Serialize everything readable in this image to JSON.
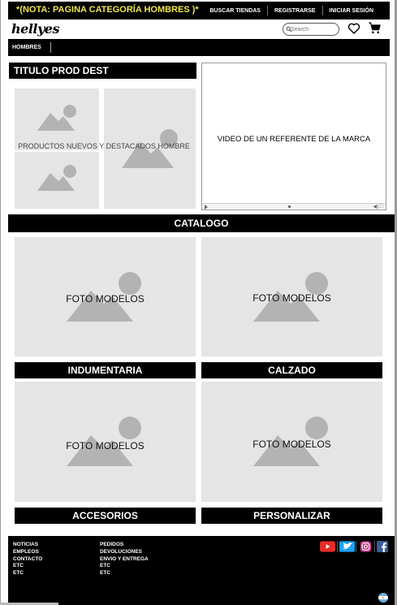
{
  "topbar": {
    "note": "*(NOTA: PAGINA CATEGORÍA HOMBRES )*",
    "links": [
      "BUSCAR TIENDAS",
      "REGISTRARSE",
      "INICIAR SESIÓN"
    ]
  },
  "header": {
    "logo": "hellyes",
    "search_placeholder": "Search"
  },
  "nav": {
    "items": [
      "HOMBRES"
    ]
  },
  "featured": {
    "title": "TITULO PROD DEST",
    "caption": "PRODUCTOS NUEVOS Y DESTACADOS HOMBRE"
  },
  "video": {
    "text": "VIDEO DE UN REFERENTE DE LA MARCA"
  },
  "catalog": {
    "title": "CATALOGO",
    "items": [
      {
        "photo_label": "FOTO MODELOS",
        "title": "INDUMENTARIA"
      },
      {
        "photo_label": "FOTO MODELOS",
        "title": "CALZADO"
      },
      {
        "photo_label": "FOTO MODELOS",
        "title": "ACCESORIOS"
      },
      {
        "photo_label": "FOTO MODELOS",
        "title": "PERSONALIZAR"
      }
    ]
  },
  "footer": {
    "col1": [
      "NOTICIAS",
      "EMPLEOS",
      "CONTACTO",
      "ETC",
      "ETC"
    ],
    "col2": [
      "PEDIDOS",
      "DEVOLUCIONES",
      "ENVIO Y ENTREGA",
      "ETC",
      "ETC"
    ],
    "social": [
      "youtube-icon",
      "twitter-icon",
      "instagram-icon",
      "facebook-icon"
    ]
  },
  "colors": {
    "note": "#f0e64a",
    "placeholder": "#e5e5e5",
    "placeholder_shape": "#b3b3b3",
    "youtube": "#e52d27",
    "twitter": "#1da1f2",
    "instagram": "#c13584",
    "facebook": "#3b5998"
  }
}
